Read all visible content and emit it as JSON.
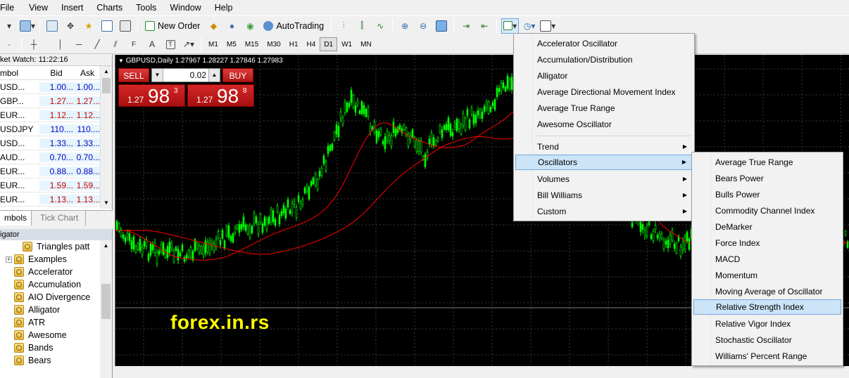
{
  "menubar": [
    "File",
    "View",
    "Insert",
    "Charts",
    "Tools",
    "Window",
    "Help"
  ],
  "toolbar": {
    "new_order": "New Order",
    "autotrading": "AutoTrading"
  },
  "timeframes": [
    "M1",
    "M5",
    "M15",
    "M30",
    "H1",
    "H4",
    "D1",
    "W1",
    "MN"
  ],
  "active_timeframe": "D1",
  "market_watch": {
    "title": "ket Watch: 11:22:16",
    "headers": {
      "symbol": "mbol",
      "bid": "Bid",
      "ask": "Ask"
    },
    "rows": [
      {
        "symbol": "USD...",
        "bid": "1.00...",
        "ask": "1.00..."
      },
      {
        "symbol": "GBP...",
        "bid": "1.27...",
        "ask": "1.27..."
      },
      {
        "symbol": "EUR...",
        "bid": "1.12...",
        "ask": "1.12..."
      },
      {
        "symbol": "USDJPY",
        "bid": "110....",
        "ask": "110...."
      },
      {
        "symbol": "USD...",
        "bid": "1.33...",
        "ask": "1.33..."
      },
      {
        "symbol": "AUD...",
        "bid": "0.70...",
        "ask": "0.70..."
      },
      {
        "symbol": "EUR...",
        "bid": "0.88...",
        "ask": "0.88..."
      },
      {
        "symbol": "EUR...",
        "bid": "1.59...",
        "ask": "1.59..."
      },
      {
        "symbol": "EUR...",
        "bid": "1.13...",
        "ask": "1.13..."
      }
    ],
    "tabs": [
      "mbols",
      "Tick Chart"
    ]
  },
  "navigator": {
    "title": "igator",
    "items": [
      "Triangles patt",
      "Examples",
      "Accelerator",
      "Accumulation",
      "AIO Divergence",
      "Alligator",
      "ATR",
      "Awesome",
      "Bands",
      "Bears"
    ]
  },
  "chart": {
    "label": "GBPUSD,Daily  1.27967 1.28227 1.27846 1.27983",
    "watermark": "forex.in.rs",
    "colors": {
      "candles": "#00ff00",
      "ma": "#ff0000",
      "background": "#000000",
      "grid": "#3a3a3a"
    }
  },
  "one_click": {
    "sell": "SELL",
    "buy": "BUY",
    "lot": "0.02",
    "sell_small": "1.27",
    "sell_big": "98",
    "sell_sup": "3",
    "buy_small": "1.27",
    "buy_big": "98",
    "buy_sup": "8"
  },
  "indicators_menu": {
    "items": [
      "Accelerator Oscillator",
      "Accumulation/Distribution",
      "Alligator",
      "Average Directional Movement Index",
      "Average True Range",
      "Awesome Oscillator"
    ],
    "submenus": [
      "Trend",
      "Oscillators",
      "Volumes",
      "Bill Williams",
      "Custom"
    ],
    "highlighted": "Oscillators"
  },
  "oscillators_menu": {
    "items": [
      "Average True Range",
      "Bears Power",
      "Bulls Power",
      "Commodity Channel Index",
      "DeMarker",
      "Force Index",
      "MACD",
      "Momentum",
      "Moving Average of Oscillator",
      "Relative Strength Index",
      "Relative Vigor Index",
      "Stochastic Oscillator",
      "Williams' Percent Range"
    ],
    "highlighted": "Relative Strength Index"
  }
}
